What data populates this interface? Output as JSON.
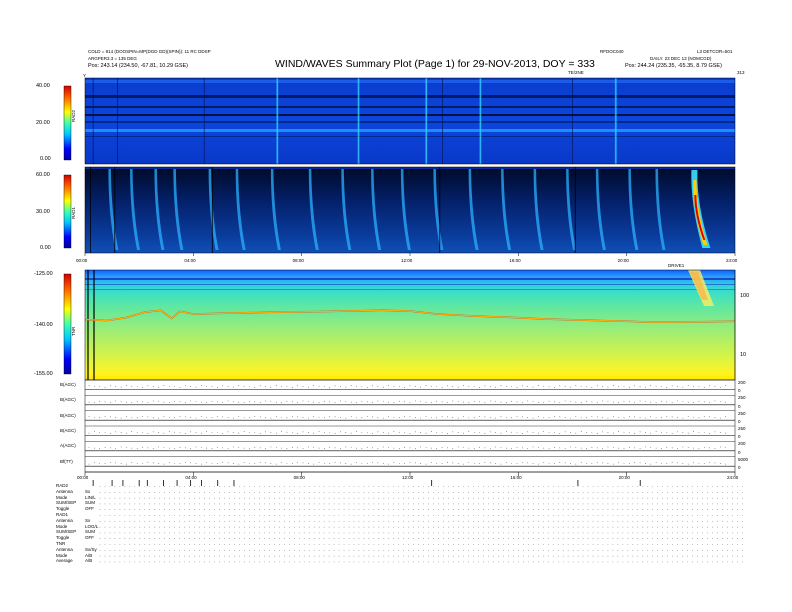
{
  "header": {
    "title": "WIND/WAVES Summary Plot (Page 1) for 29-NOV-2013, DOY = 333",
    "left_line1": "COLD = 814 (DOOSPIN=MP(DGD GD)(SPIN)): 11 RC DDSP",
    "left_line2": "ARGPER3.3 = 135 DEG",
    "left_line3": "Pos: 243.14 (234.50, -67.81, 10.29 GSE)",
    "right_id1": "RFDOC040",
    "right_id2": "L3 DETCOR=501",
    "right_line2": "DAILY. 23 DEC 13 (NOMCGD)",
    "right_line3": "Pos: 244.24 (235.35, -65.35, 8.79 GSE)",
    "te_lbl": "TE/2NE",
    "lbl_y": "Y",
    "lbl_r": "313"
  },
  "panels": {
    "rad2": {
      "label": "RAD2",
      "ticks": [
        "40.00",
        "20.00",
        "0.00"
      ]
    },
    "rad1": {
      "label": "RAD1",
      "ticks": [
        "60.00",
        "30.00",
        "0.00"
      ]
    },
    "tnr": {
      "label": "TNR",
      "ticks": [
        "-125.00",
        "-140.00",
        "-155.00"
      ],
      "right_ticks": [
        "100",
        "10"
      ],
      "corner": "DRIVE1"
    }
  },
  "time_ticks": [
    "00:00",
    "04:00",
    "08:00",
    "12:00",
    "16:00",
    "20:00",
    "24:00"
  ],
  "chart_data": [
    {
      "type": "heatmap",
      "name": "RAD2",
      "x": {
        "label": "UT",
        "range": [
          "00:00",
          "24:00"
        ]
      },
      "y": {
        "range": [
          0,
          40
        ],
        "ticks": [
          0,
          20,
          40
        ]
      },
      "features": [
        {
          "type": "burst",
          "time_h": 7.1
        },
        {
          "type": "burst",
          "time_h": 10.1
        },
        {
          "type": "burst",
          "time_h": 12.6
        },
        {
          "type": "burst",
          "time_h": 14.6
        },
        {
          "type": "burst",
          "time_h": 19.6
        }
      ]
    },
    {
      "type": "heatmap",
      "name": "RAD1",
      "y": {
        "range": [
          0,
          60
        ],
        "ticks": [
          0,
          30,
          60
        ]
      },
      "features": [
        {
          "type": "burst",
          "time_h": 0.9
        },
        {
          "type": "burst",
          "time_h": 1.7
        },
        {
          "type": "burst",
          "time_h": 2.6
        },
        {
          "type": "burst",
          "time_h": 3.3
        },
        {
          "type": "burst",
          "time_h": 4.6
        },
        {
          "type": "burst",
          "time_h": 5.6
        },
        {
          "type": "burst",
          "time_h": 6.9
        },
        {
          "type": "burst",
          "time_h": 8.3
        },
        {
          "type": "burst",
          "time_h": 9.5
        },
        {
          "type": "burst",
          "time_h": 10.6
        },
        {
          "type": "burst",
          "time_h": 11.7
        },
        {
          "type": "burst",
          "time_h": 12.9
        },
        {
          "type": "burst",
          "time_h": 14.2
        },
        {
          "type": "burst",
          "time_h": 15.4
        },
        {
          "type": "burst",
          "time_h": 16.6
        },
        {
          "type": "burst",
          "time_h": 17.8
        },
        {
          "type": "burst",
          "time_h": 18.9
        },
        {
          "type": "burst",
          "time_h": 20.1
        },
        {
          "type": "burst",
          "time_h": 21.1
        },
        {
          "type": "strong-burst",
          "time_h": 22.5
        }
      ]
    },
    {
      "type": "heatmap",
      "name": "TNR",
      "y": {
        "range": [
          -155,
          -125
        ],
        "ticks": [
          -155,
          -140,
          -125
        ],
        "right_ticks": [
          10,
          100
        ]
      },
      "trace": [
        {
          "t": 0.0,
          "y": -138.5
        },
        {
          "t": 0.8,
          "y": -138.8
        },
        {
          "t": 1.5,
          "y": -138.0
        },
        {
          "t": 2.2,
          "y": -136.5
        },
        {
          "t": 2.8,
          "y": -136.0
        },
        {
          "t": 3.2,
          "y": -138.2
        },
        {
          "t": 3.5,
          "y": -136.3
        },
        {
          "t": 4.0,
          "y": -137.0
        },
        {
          "t": 5.0,
          "y": -136.8
        },
        {
          "t": 7.0,
          "y": -136.5
        },
        {
          "t": 9.0,
          "y": -136.3
        },
        {
          "t": 11.0,
          "y": -136.0
        },
        {
          "t": 12.0,
          "y": -136.2
        },
        {
          "t": 13.0,
          "y": -137.0
        },
        {
          "t": 14.5,
          "y": -137.6
        },
        {
          "t": 16.0,
          "y": -138.0
        },
        {
          "t": 17.0,
          "y": -138.4
        },
        {
          "t": 19.0,
          "y": -138.8
        },
        {
          "t": 21.0,
          "y": -139.2
        },
        {
          "t": 23.0,
          "y": -139.1
        },
        {
          "t": 24.0,
          "y": -139.0
        }
      ]
    }
  ],
  "lines": {
    "labels": [
      "B(AGC)",
      "B(AGC)",
      "B(AGC)",
      "B(AGC)",
      "A(AGC)",
      "Bf(TT)"
    ],
    "right_ticks": [
      "200",
      "0",
      "250",
      "0",
      "250",
      "0",
      "250",
      "0",
      "200",
      "0",
      "5000",
      "0"
    ]
  },
  "bottom_ticks": [
    "00:00",
    "04:00",
    "08:00",
    "12:00",
    "16:00",
    "20:00",
    "24:00"
  ],
  "legend": {
    "sections": [
      {
        "heading": "RAD2",
        "rows": [
          [
            "Antenna",
            "Sx"
          ],
          [
            "Mode",
            "LIN/L"
          ],
          [
            "SUM/SEP",
            "SUM"
          ],
          [
            "Toggle",
            "OFF"
          ]
        ]
      },
      {
        "heading": "RAD1",
        "rows": [
          [
            "Antenna",
            "Sx"
          ],
          [
            "Mode",
            "LOG/L"
          ],
          [
            "SUM/SEP",
            "SUM"
          ],
          [
            "Toggle",
            "OFF"
          ]
        ]
      },
      {
        "heading": "TNR",
        "rows": [
          [
            "Antenna",
            "Sx/Sy"
          ],
          [
            "Mode",
            "A/B"
          ],
          [
            "Average",
            "A/B"
          ]
        ]
      }
    ]
  }
}
